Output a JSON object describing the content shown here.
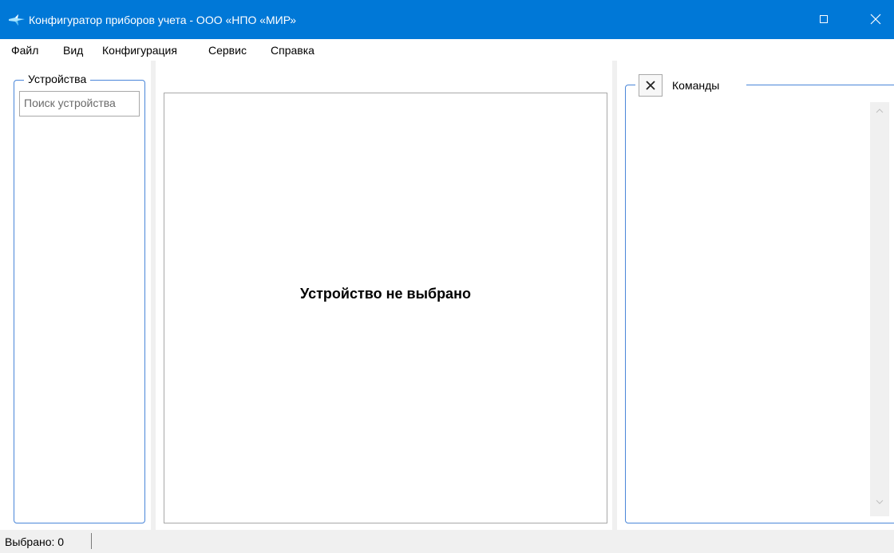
{
  "window": {
    "title": "Конфигуратор приборов учета - ООО «НПО «МИР»",
    "title_bar_color": "#0078d7"
  },
  "menu": {
    "items": [
      "Файл",
      "Вид",
      "Конфигурация",
      "Сервис",
      "Справка"
    ]
  },
  "devices_panel": {
    "title": "Устройства",
    "search_placeholder": "Поиск устройства"
  },
  "center_panel": {
    "message": "Устройство не выбрано"
  },
  "commands_panel": {
    "title": "Команды",
    "close_icon": "close-icon"
  },
  "status_bar": {
    "selected_label": "Выбрано:",
    "selected_count": "0"
  },
  "colors": {
    "accent": "#0078d7",
    "group_border": "#4a86d9",
    "chrome_background": "#f0f0f0"
  }
}
